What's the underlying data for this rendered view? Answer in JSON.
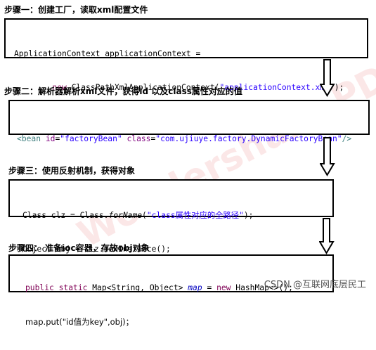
{
  "steps": [
    {
      "title": "步骤一：创建工厂，读取xml配置文件",
      "code_lines": [
        [
          "ApplicationContext applicationContext ="
        ],
        [
          "        ",
          {
            "kw": "new"
          },
          " ClassPathXmlApplicationContext(",
          {
            "str": "\"applicationContext.xml\""
          },
          ");"
        ]
      ]
    },
    {
      "title": "步骤二：解析器解析xml文件，获得id 以及class属性对应的值",
      "code_lines": [
        [
          "<bean id=\"factoryBean\" class=\"com.ujiuye.factory.DynamicFactoryBean\"/>"
        ]
      ]
    },
    {
      "title": "步骤三：使用反射机制，获得对象",
      "code_lines": [
        [
          "Class clz = Class.forName(\"class属性对应的全路径\");"
        ],
        [
          "Object obj = clz.newInstance();"
        ]
      ]
    },
    {
      "title": "步骤四：  准备ioc容器，存放obj对象",
      "code_lines": [
        [
          "public static Map<String, Object> map = new HashMap<>();"
        ],
        [
          "map.put(\"id值为key\",obj)；"
        ]
      ]
    }
  ],
  "step1": {
    "line1": "ApplicationContext applicationContext =",
    "line2_indent": "        ",
    "line2_kw": "new",
    "line2_mid": " ClassPathXmlApplicationContext(",
    "line2_str": "\"applicationContext.xml\"",
    "line2_end": ");"
  },
  "step2": {
    "lt": "<",
    "tag": "bean",
    "attr1": " id",
    "eq1": "=",
    "val1": "\"factoryBean\"",
    "attr2": " class",
    "eq2": "=",
    "val2": "\"com.ujiuye.factory.DynamicFactoryBean\"",
    "end": "/>"
  },
  "step3": {
    "line1_a": "Class clz = Class.",
    "line1_method": "forName",
    "line1_b": "(",
    "line1_str": "\"class属性对应的全路径\"",
    "line1_c": ");",
    "line2": "Object obj = clz.newInstance();"
  },
  "step4": {
    "kw1": "public",
    "kw2": " static",
    "mid": " Map<String, Object> ",
    "field": "map",
    "eq": " = ",
    "kw3": "new",
    "end": " HashMap<>();",
    "line2": "map.put(\"id值为key\",obj)；"
  },
  "watermark": "Wondershare PDF编辑试",
  "credit": "CSDN @互联网底层民工",
  "colors": {
    "keyword": "#7f0055",
    "string": "#2a00ff",
    "field": "#0000c0",
    "xml_tag": "#3f7f7f",
    "xml_attr": "#7f007f"
  },
  "icons": [
    "down-arrow-icon",
    "down-arrow-icon",
    "down-arrow-icon"
  ]
}
